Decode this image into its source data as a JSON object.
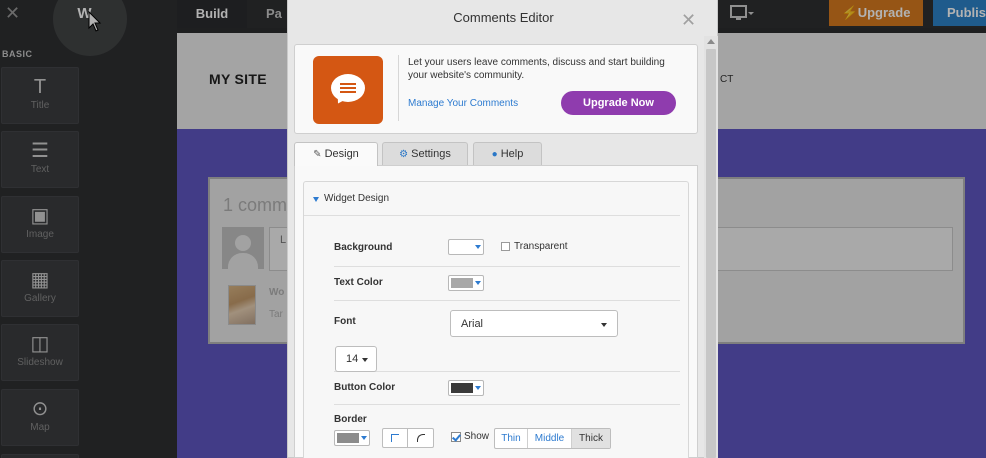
{
  "editor": {
    "close_glyph": "✕",
    "logo_letter": "W",
    "section_label": "BASIC",
    "tools": [
      {
        "label": "Title",
        "icon": "title-icon",
        "glyph": "T"
      },
      {
        "label": "Text",
        "icon": "text-lines-icon",
        "glyph": "☰"
      },
      {
        "label": "Image",
        "icon": "image-icon",
        "glyph": "▣"
      },
      {
        "label": "Gallery",
        "icon": "gallery-grid-icon",
        "glyph": "▦"
      },
      {
        "label": "Slideshow",
        "icon": "slideshow-icon",
        "glyph": "◫"
      },
      {
        "label": "Map",
        "icon": "map-pin-icon",
        "glyph": "⊙"
      }
    ]
  },
  "topbar": {
    "build_label": "Build",
    "pages_label": "Pa",
    "upgrade_label": "⚡Upgrade",
    "publish_label": "Publis"
  },
  "site": {
    "title": "MY SITE",
    "nav_fragment": "CT",
    "comment_count": "1 comm",
    "input_placeholder": "L",
    "commenter_name": "Wo",
    "comment_snippet": "Tar"
  },
  "modal": {
    "title": "Comments Editor",
    "close_glyph": "✕",
    "promo_text": "Let your users leave comments, discuss and start building your website's community.",
    "manage_link": "Manage Your Comments",
    "upgrade_button": "Upgrade Now",
    "tabs": [
      {
        "label": "Design",
        "icon": "paintbrush-icon",
        "glyph": "✎",
        "active": true
      },
      {
        "label": "Settings",
        "icon": "gear-icon",
        "glyph": "⚙",
        "active": false
      },
      {
        "label": "Help",
        "icon": "user-icon",
        "glyph": "●",
        "active": false
      }
    ],
    "section_title": "Widget Design",
    "background_label": "Background",
    "background_color": "#ffffff",
    "transparent_label": "Transparent",
    "transparent_checked": false,
    "text_color_label": "Text Color",
    "text_color": "#a8a8a8",
    "font_label": "Font",
    "font_value": "Arial",
    "font_size_value": "14",
    "button_color_label": "Button Color",
    "button_color": "#3a3a3a",
    "border_label": "Border",
    "border_color": "#8c8c8c",
    "show_label": "Show",
    "show_checked": true,
    "thickness_options": [
      "Thin",
      "Middle",
      "Thick"
    ],
    "thickness_selected": "Thick"
  },
  "colors": {
    "upgrade_orange": "#d77a1f",
    "publish_blue": "#2d83c9",
    "upgrade_purple": "#8f3cae",
    "hero_purple": "#5f56c2",
    "comments_orange": "#d45713",
    "link_blue": "#2d7bd0"
  }
}
